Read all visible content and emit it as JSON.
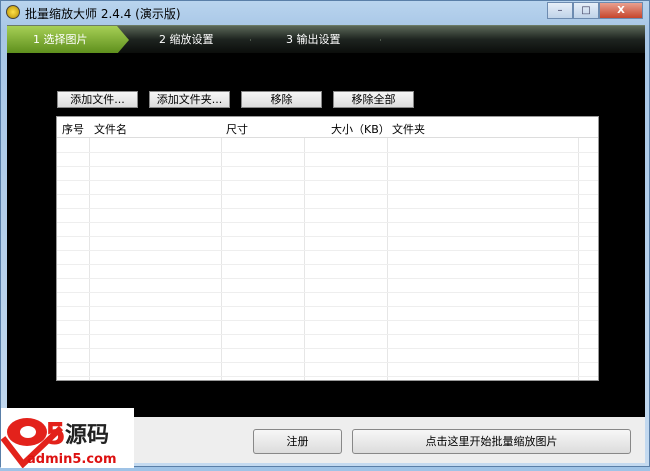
{
  "window": {
    "title": "批量缩放大师 2.4.4 (演示版)",
    "minimize": "–",
    "maximize": "□",
    "close": "X"
  },
  "wizard": {
    "steps": [
      {
        "label": "1 选择图片"
      },
      {
        "label": "2 缩放设置"
      },
      {
        "label": "3 输出设置"
      }
    ]
  },
  "toolbar": {
    "add_file": "添加文件...",
    "add_folder": "添加文件夹...",
    "remove": "移除",
    "remove_all": "移除全部"
  },
  "table": {
    "columns": [
      "序号",
      "文件名",
      "尺寸",
      "大小（KB）",
      "文件夹"
    ],
    "rows": []
  },
  "footer": {
    "register": "注册",
    "start": "点击这里开始批量缩放图片"
  },
  "watermark": {
    "brand": "a5源码",
    "site": "admin5.com"
  }
}
